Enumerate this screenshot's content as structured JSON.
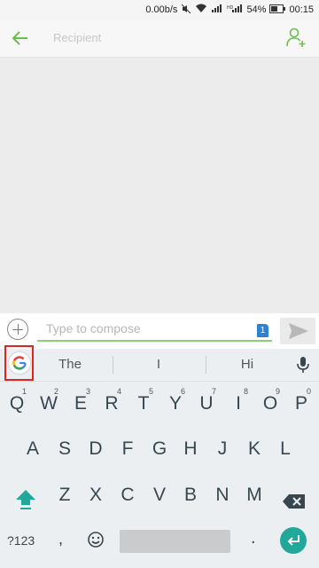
{
  "status": {
    "speed": "0.00b/s",
    "battery": "54%",
    "time": "00:15"
  },
  "topbar": {
    "recipient_placeholder": "Recipient"
  },
  "composer": {
    "placeholder": "Type to compose",
    "sim_badge": "1"
  },
  "keyboard": {
    "suggestions": [
      "The",
      "I",
      "Hi"
    ],
    "row1": [
      {
        "k": "Q",
        "h": "1"
      },
      {
        "k": "W",
        "h": "2"
      },
      {
        "k": "E",
        "h": "3"
      },
      {
        "k": "R",
        "h": "4"
      },
      {
        "k": "T",
        "h": "5"
      },
      {
        "k": "Y",
        "h": "6"
      },
      {
        "k": "U",
        "h": "7"
      },
      {
        "k": "I",
        "h": "8"
      },
      {
        "k": "O",
        "h": "9"
      },
      {
        "k": "P",
        "h": "0"
      }
    ],
    "row2": [
      "A",
      "S",
      "D",
      "F",
      "G",
      "H",
      "J",
      "K",
      "L"
    ],
    "row3": [
      "Z",
      "X",
      "C",
      "V",
      "B",
      "N",
      "M"
    ],
    "symbols_label": "?123",
    "comma": ",",
    "period": "."
  },
  "icons": {
    "back": "back-arrow-icon",
    "add_person": "add-person-icon",
    "plus": "plus-circle-icon",
    "send": "send-icon",
    "google": "google-icon",
    "mic": "microphone-icon",
    "shift": "shift-icon",
    "backspace": "backspace-icon",
    "emoji": "emoji-icon",
    "enter": "enter-icon"
  },
  "colors": {
    "accent": "#6bbf4b",
    "keyboard_accent": "#21a89a",
    "badge": "#2e82d6",
    "highlight": "#e0241f"
  }
}
